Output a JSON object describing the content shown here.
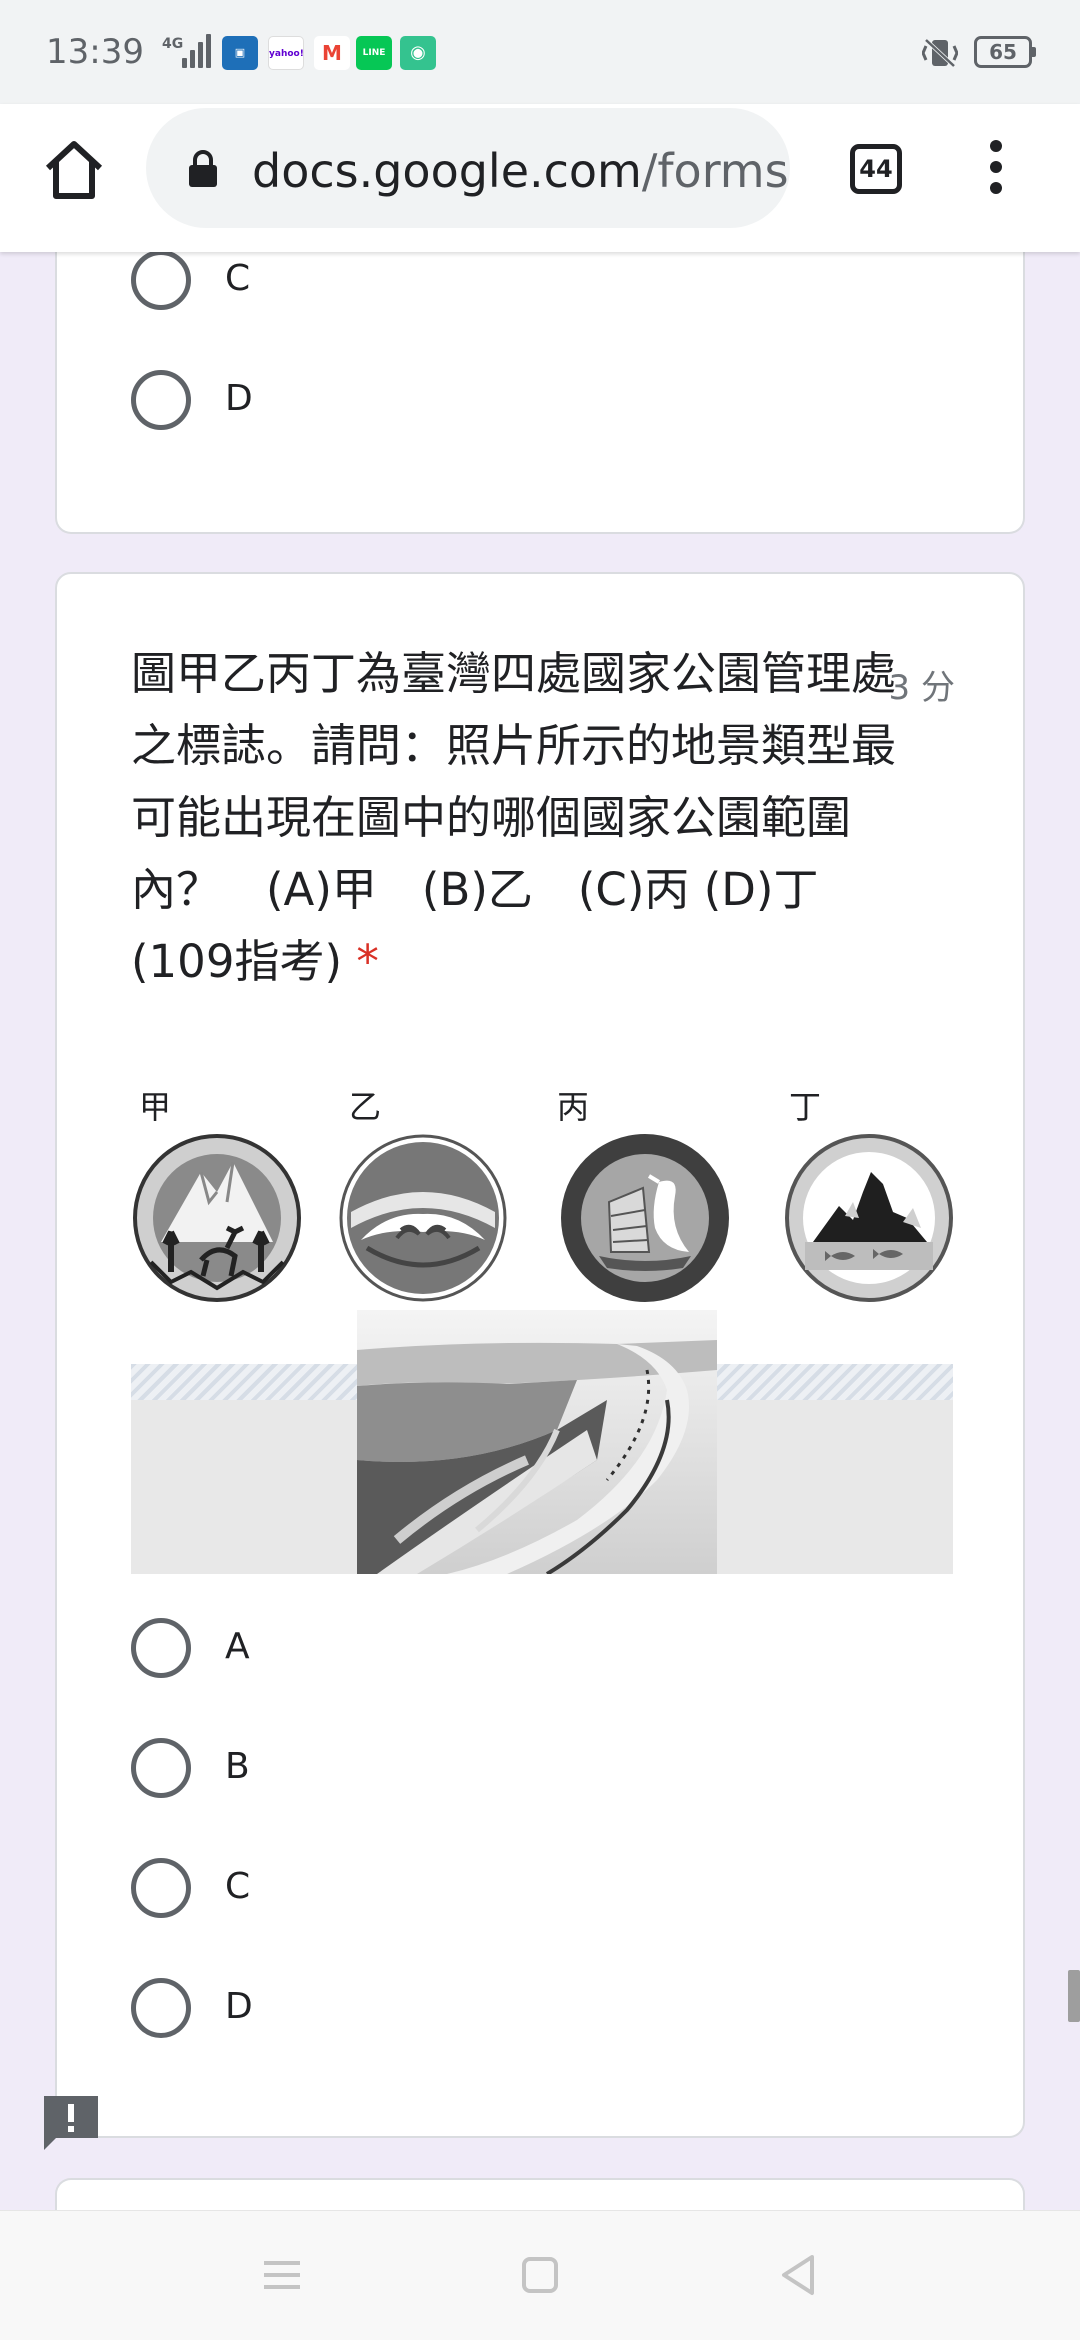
{
  "status_bar": {
    "time": "13:39",
    "network": "4G",
    "battery": "65",
    "app_icons": [
      "app-icon",
      "yahoo-mail-icon",
      "gmail-icon",
      "line-icon",
      "chat-icon"
    ],
    "yahoo_label": "yahoo!",
    "line_label": "LINE"
  },
  "browser": {
    "url_domain": "docs.google.com",
    "url_path": "/forms",
    "tab_count": "44"
  },
  "previous_question": {
    "options": [
      "C",
      "D"
    ]
  },
  "question": {
    "text": "圖甲乙丙丁為臺灣四處國家公園管理處之標誌。請問：照片所示的地景類型最可能出現在圖中的哪個國家公園範圍內？　(A)甲　(B)乙　(C)丙 (D)丁 (109指考)",
    "required_mark": "*",
    "points": "3 分",
    "logo_labels": [
      "甲",
      "乙",
      "丙",
      "丁"
    ],
    "options": [
      "A",
      "B",
      "C",
      "D"
    ]
  },
  "colors": {
    "background": "#f0ebf8",
    "required": "#d93025",
    "radio_border": "#5f6368"
  }
}
